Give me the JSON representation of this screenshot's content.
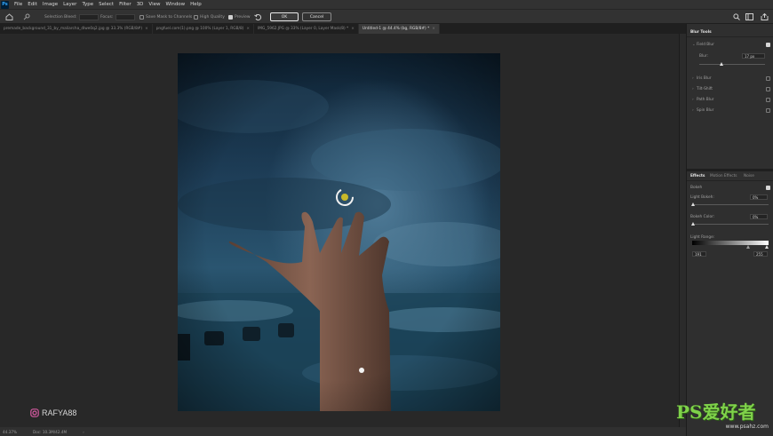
{
  "app": {
    "logo": "Ps"
  },
  "menu": [
    "File",
    "Edit",
    "Image",
    "Layer",
    "Type",
    "Select",
    "Filter",
    "3D",
    "View",
    "Window",
    "Help"
  ],
  "options_bar": {
    "selection_bleed": "Selection Bleed:",
    "focus": "Focus:",
    "save_mask": "Save Mask to Channels",
    "high_quality": "High Quality",
    "preview": "Preview",
    "ok": "OK",
    "cancel": "Cancel"
  },
  "tabs": [
    {
      "label": "premade_background_31_by_maliarcha_dlwe0q2.jpg @ 33.3% (RGB/8#)",
      "active": false
    },
    {
      "label": "pngfuel.com(1).png @ 100% (Layer 1, RGB/8)",
      "active": false
    },
    {
      "label": "IMG_5962.JPG @ 33% (Layer 0, Layer Mask/8) *",
      "active": false
    },
    {
      "label": "Untitled-1 @ 44.4% (bg, RGB/8#) *",
      "active": true
    }
  ],
  "panel": {
    "title": "Blur Tools",
    "field_blur": {
      "label": "Field Blur",
      "checked": true,
      "blur_label": "Blur:",
      "blur_value": "17 px",
      "slider_fraction": 0.34
    },
    "other_blurs": [
      {
        "label": "Iris Blur",
        "checked": false
      },
      {
        "label": "Tilt-Shift",
        "checked": false
      },
      {
        "label": "Path Blur",
        "checked": false
      },
      {
        "label": "Spin Blur",
        "checked": false
      }
    ],
    "effects_tabs": [
      "Effects",
      "Motion Effects",
      "Noise"
    ],
    "bokeh": {
      "label": "Bokeh",
      "checked": true
    },
    "light_bokeh": {
      "label": "Light Bokeh:",
      "value": "0%"
    },
    "bokeh_color": {
      "label": "Bokeh Color:",
      "value": "0%"
    },
    "light_range": {
      "label": "Light Range:",
      "low": "191",
      "high": "255"
    }
  },
  "status": {
    "zoom": "44.37%",
    "doc": "Doc: 10.3M/42.4M"
  },
  "watermark": {
    "name": "RAFYA88",
    "site_logo": "PS爱好者",
    "site_url": "www.psahz.com"
  },
  "colors": {
    "accent": "#31a8ff",
    "sky": "#1f3e57",
    "pin": "#c8b92a"
  }
}
